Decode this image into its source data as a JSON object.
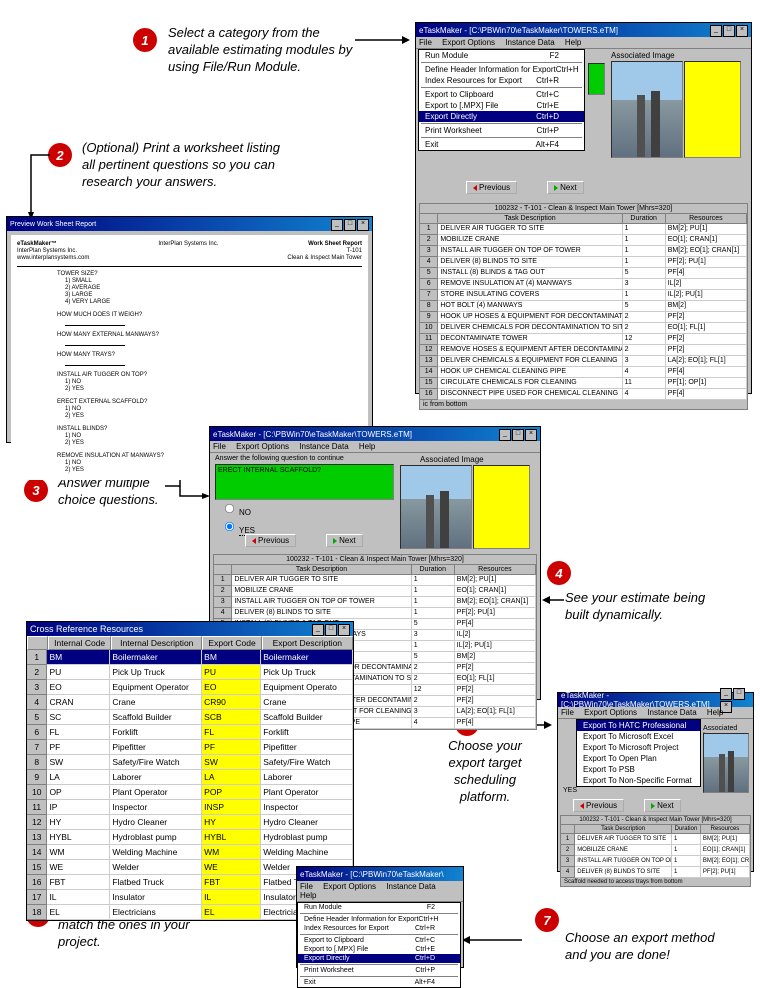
{
  "steps": {
    "1": "Select a category from the available estimating modules by using File/Run Module.",
    "2": "(Optional) Print a worksheet listing all pertinent questions so you can research your answers.",
    "3": "Answer multiple choice questions.",
    "4": "See your estimate being built dynamically.",
    "5": "Map internal resources to match the ones in your project.",
    "6": "Choose your export target scheduling platform.",
    "7": "Choose an export method and you are done!"
  },
  "app_title": "eTaskMaker - [C:\\PBWin70\\eTaskMaker\\TOWERS.eTM]",
  "app_title_short": "eTaskMaker - [C:\\PBWin70\\eTaskMaker\\",
  "menubar": {
    "file": "File",
    "export": "Export Options",
    "instance": "Instance Data",
    "help": "Help"
  },
  "export_menu": {
    "hatc": "Export To HATC Professional",
    "excel": "Export To Microsoft Excel",
    "project": "Export To Microsoft Project",
    "openplan": "Export To Open Plan",
    "psb": "Export To PSB",
    "nonspec": "Export To Non-Specific Format"
  },
  "file_menu": {
    "run": "Run Module",
    "run_sc": "F2",
    "hdr": "Define Header Information for Export",
    "hdr_sc": "Ctrl+H",
    "idx": "Index Resources for Export",
    "idx_sc": "Ctrl+R",
    "clip": "Export to Clipboard",
    "clip_sc": "Ctrl+C",
    "mpx": "Export to [.MPX] File",
    "mpx_sc": "Ctrl+E",
    "direct": "Export Directly",
    "direct_sc": "Ctrl+D",
    "print": "Print Worksheet",
    "print_sc": "Ctrl+P",
    "exit": "Exit",
    "exit_sc": "Alt+F4"
  },
  "assoc_label": "Associated Image",
  "prev": "Previous",
  "next": "Next",
  "question_prompt": "Answer the following question to continue",
  "question_text": "ERECT INTERNAL SCAFFOLD?",
  "opt_no": "NO",
  "opt_yes": "YES",
  "grid_title": "100232 - T-101 - Clean & Inspect Main Tower [Mhrs=320]",
  "grid_cols": {
    "desc": "Task Description",
    "dur": "Duration",
    "res": "Resources"
  },
  "grid_status1": "ic from bottom",
  "grid_status2": "Scaffold needed to access trays from bottom",
  "tasks": [
    {
      "n": 1,
      "d": "DELIVER AIR TUGGER TO SITE",
      "dur": "1",
      "r": "BM[2]; PU[1]"
    },
    {
      "n": 2,
      "d": "MOBILIZE CRANE",
      "dur": "1",
      "r": "EO[1]; CRAN[1]"
    },
    {
      "n": 3,
      "d": "INSTALL AIR TUGGER ON TOP OF TOWER",
      "dur": "1",
      "r": "BM[2]; EO[1]; CRAN[1]"
    },
    {
      "n": 4,
      "d": "DELIVER (8) BLINDS TO SITE",
      "dur": "1",
      "r": "PF[2]; PU[1]"
    },
    {
      "n": 5,
      "d": "INSTALL (8) BLINDS & TAG OUT",
      "dur": "5",
      "r": "PF[4]"
    },
    {
      "n": 6,
      "d": "REMOVE INSULATION AT (4) MANWAYS",
      "dur": "3",
      "r": "IL[2]"
    },
    {
      "n": 7,
      "d": "STORE INSULATING COVERS",
      "dur": "1",
      "r": "IL[2]; PU[1]"
    },
    {
      "n": 8,
      "d": "HOT BOLT (4) MANWAYS",
      "dur": "5",
      "r": "BM[2]"
    },
    {
      "n": 9,
      "d": "HOOK UP HOSES & EQUIPMENT FOR DECONTAMINATION",
      "dur": "2",
      "r": "PF[2]"
    },
    {
      "n": 10,
      "d": "DELIVER CHEMICALS FOR DECONTAMINATION TO SITE",
      "dur": "2",
      "r": "EO[1]; FL[1]"
    },
    {
      "n": 11,
      "d": "DECONTAMINATE TOWER",
      "dur": "12",
      "r": "PF[2]"
    },
    {
      "n": 12,
      "d": "REMOVE HOSES & EQUIPMENT AFTER DECONTAMINATION",
      "dur": "2",
      "r": "PF[2]"
    },
    {
      "n": 13,
      "d": "DELIVER CHEMICALS & EQUIPMENT FOR CLEANING",
      "dur": "3",
      "r": "LA[2]; EO[1]; FL[1]"
    },
    {
      "n": 14,
      "d": "HOOK UP CHEMICAL CLEANING PIPE",
      "dur": "4",
      "r": "PF[4]"
    },
    {
      "n": 15,
      "d": "CIRCULATE CHEMICALS FOR CLEANING",
      "dur": "11",
      "r": "PF[1]; OP[1]"
    },
    {
      "n": 16,
      "d": "DISCONNECT PIPE USED FOR CHEMICAL CLEANING",
      "dur": "4",
      "r": "PF[4]"
    }
  ],
  "tasks_short": [
    {
      "n": 1,
      "d": "DELIVER AIR TUGGER TO SITE",
      "dur": "1",
      "r": "BM[2]; PU[1]"
    },
    {
      "n": 2,
      "d": "MOBILIZE CRANE",
      "dur": "1",
      "r": "EO[1]; CRAN[1]"
    },
    {
      "n": 3,
      "d": "INSTALL AIR TUGGER ON TOP OF TOWER",
      "dur": "1",
      "r": "BM[2]; EO[1]; CRAN[1]"
    },
    {
      "n": 4,
      "d": "DELIVER (8) BLINDS TO SITE",
      "dur": "1",
      "r": "PF[2]; PU[1]"
    }
  ],
  "cross_ref_title": "Cross Reference Resources",
  "cr_cols": {
    "ic": "Internal Code",
    "id": "Internal Description",
    "ec": "Export Code",
    "ed": "Export Description"
  },
  "cr_rows": [
    {
      "n": 1,
      "ic": "BM",
      "id": "Boilermaker",
      "ec": "BM",
      "ed": "Boilermaker"
    },
    {
      "n": 2,
      "ic": "PU",
      "id": "Pick Up Truck",
      "ec": "PU",
      "ed": "Pick Up Truck"
    },
    {
      "n": 3,
      "ic": "EO",
      "id": "Equipment Operator",
      "ec": "EO",
      "ed": "Equipment Operato"
    },
    {
      "n": 4,
      "ic": "CRAN",
      "id": "Crane",
      "ec": "CR90",
      "ed": "Crane"
    },
    {
      "n": 5,
      "ic": "SC",
      "id": "Scaffold Builder",
      "ec": "SCB",
      "ed": "Scaffold Builder"
    },
    {
      "n": 6,
      "ic": "FL",
      "id": "Forklift",
      "ec": "FL",
      "ed": "Forklift"
    },
    {
      "n": 7,
      "ic": "PF",
      "id": "Pipefitter",
      "ec": "PF",
      "ed": "Pipefitter"
    },
    {
      "n": 8,
      "ic": "SW",
      "id": "Safety/Fire Watch",
      "ec": "SW",
      "ed": "Safety/Fire Watch"
    },
    {
      "n": 9,
      "ic": "LA",
      "id": "Laborer",
      "ec": "LA",
      "ed": "Laborer"
    },
    {
      "n": 10,
      "ic": "OP",
      "id": "Plant Operator",
      "ec": "POP",
      "ed": "Plant Operator"
    },
    {
      "n": 11,
      "ic": "IP",
      "id": "Inspector",
      "ec": "INSP",
      "ed": "Inspector"
    },
    {
      "n": 12,
      "ic": "HY",
      "id": "Hydro Cleaner",
      "ec": "HY",
      "ed": "Hydro Cleaner"
    },
    {
      "n": 13,
      "ic": "HYBL",
      "id": "Hydroblast pump",
      "ec": "HYBL",
      "ed": "Hydroblast pump"
    },
    {
      "n": 14,
      "ic": "WM",
      "id": "Welding Machine",
      "ec": "WM",
      "ed": "Welding Machine"
    },
    {
      "n": 15,
      "ic": "WE",
      "id": "Welder",
      "ec": "WE",
      "ed": "Welder"
    },
    {
      "n": 16,
      "ic": "FBT",
      "id": "Flatbed Truck",
      "ec": "FBT",
      "ed": "Flatbed Truck"
    },
    {
      "n": 17,
      "ic": "IL",
      "id": "Insulator",
      "ec": "IL",
      "ed": "Insulator"
    },
    {
      "n": 18,
      "ic": "EL",
      "id": "Electricians",
      "ec": "EL",
      "ed": "Electricians"
    }
  ],
  "ws": {
    "title": "eTaskMaker™",
    "company": "InterPlan Systems Inc.",
    "url": "www.interplansystems.com",
    "rpt": "Work Sheet Report",
    "job": "T-101",
    "job2": "Clean & Inspect Main Tower",
    "q1": "TOWER SIZE?",
    "a11": "1) SMALL",
    "a12": "2) AVERAGE",
    "a13": "3) LARGE",
    "a14": "4) VERY LARGE",
    "q2": "HOW MUCH DOES IT WEIGH?",
    "q3": "HOW MANY EXTERNAL MANWAYS?",
    "q4": "HOW MANY TRAYS?",
    "q5": "INSTALL AIR TUGGER ON TOP?",
    "a51": "1) NO",
    "a52": "2) YES",
    "q6": "ERECT EXTERNAL SCAFFOLD?",
    "q7": "INSTALL BLINDS?",
    "q8": "REMOVE INSULATION AT MANWAYS?"
  }
}
